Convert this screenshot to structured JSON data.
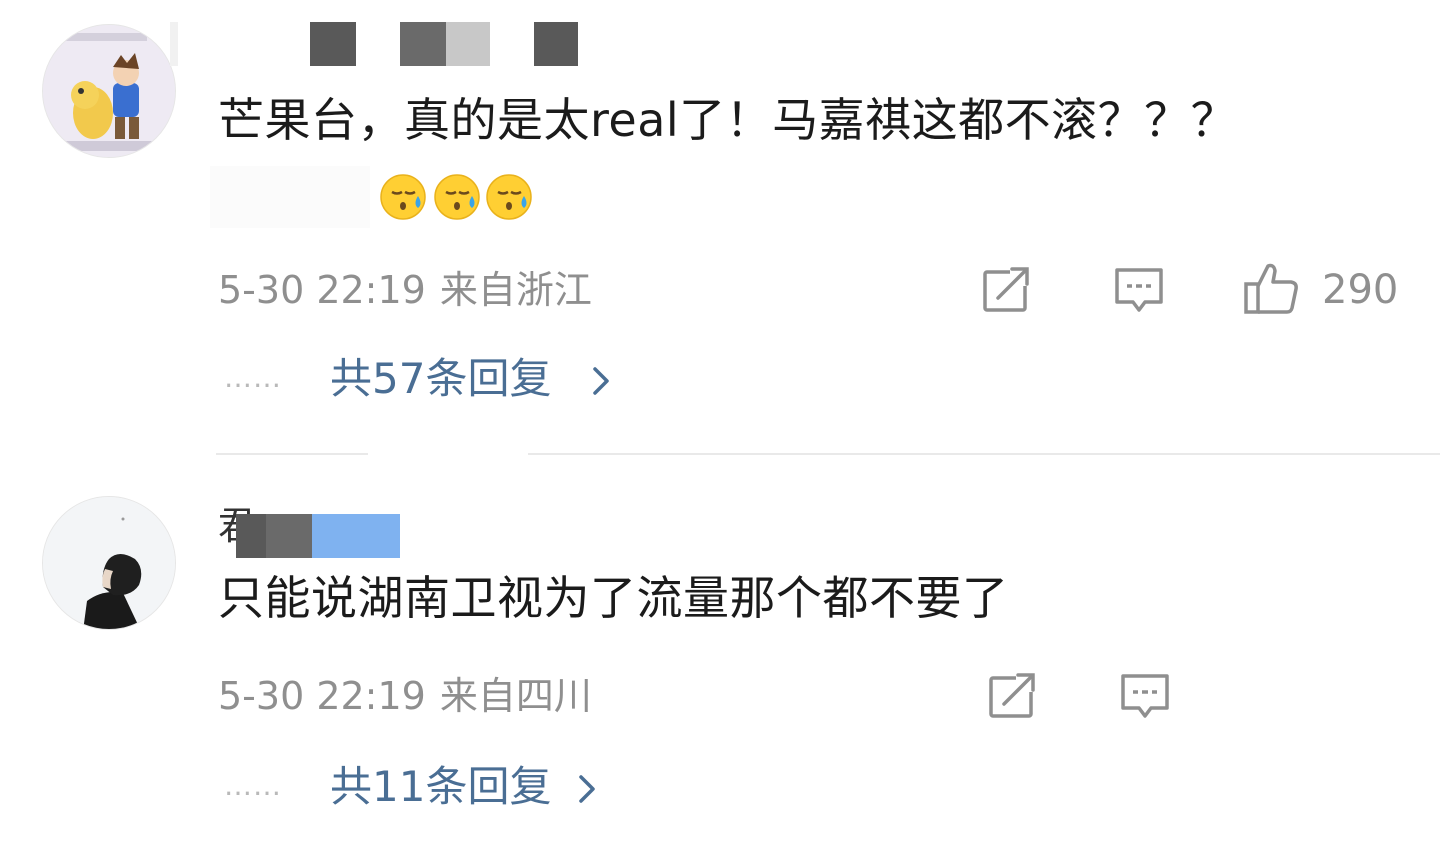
{
  "comments": [
    {
      "username_visible": "",
      "text": "芒果台，真的是太real了！马嘉祺这都不滚？？？",
      "emoji_count": 3,
      "emoji_name": "sweat-emoji",
      "date": "5-30 22:19",
      "region": "来自浙江",
      "likes": "290",
      "reply_link": "共57条回复",
      "actions": [
        "share-icon",
        "comment-icon",
        "like-icon"
      ]
    },
    {
      "username_visible": "君",
      "text": "只能说湖南卫视为了流量那个都不要了",
      "date": "5-30 22:19",
      "region": "来自四川",
      "reply_link": "共11条回复",
      "actions": [
        "share-icon",
        "comment-icon"
      ]
    }
  ],
  "ui": {
    "dots": "……",
    "accent": "#4a6e94",
    "meta_color": "#8f8f8f",
    "blur_colors": [
      "#595959",
      "#6a6a6a",
      "#c8c8c8",
      "#7fb2f0"
    ]
  }
}
